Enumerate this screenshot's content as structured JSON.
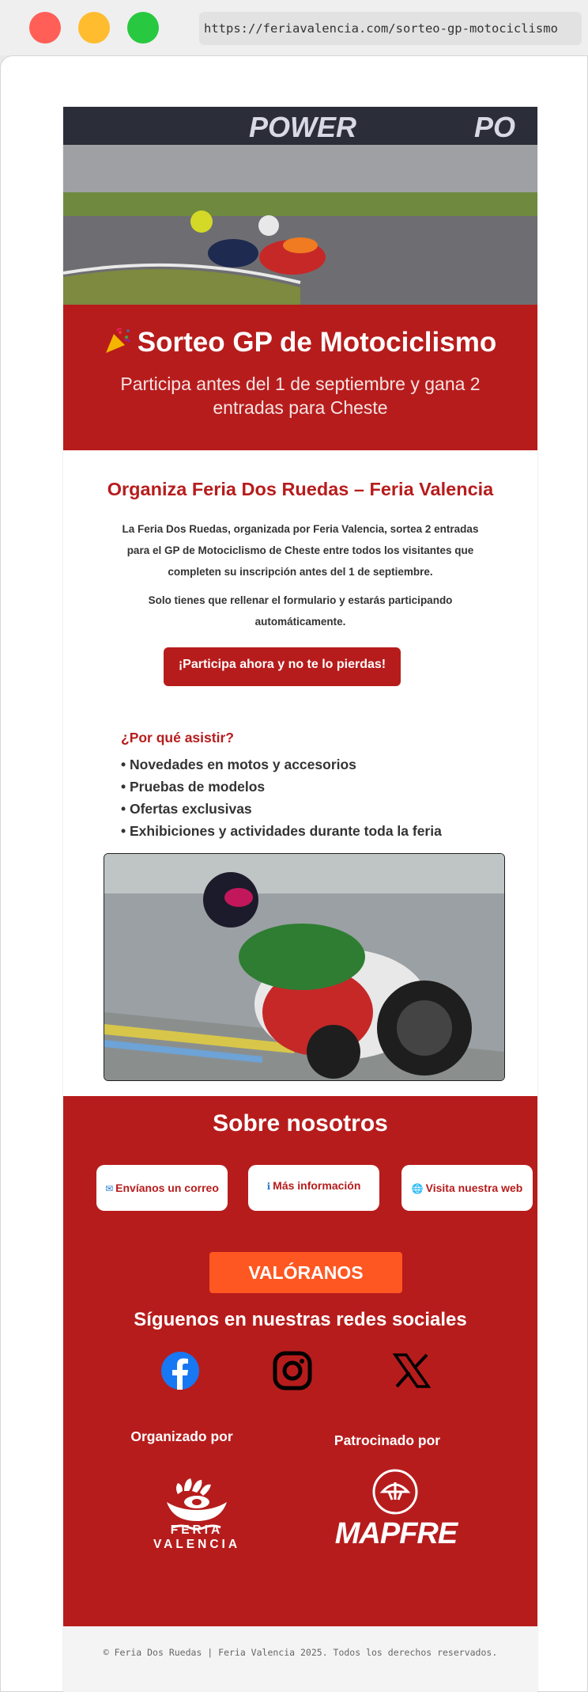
{
  "browser": {
    "url": "https://feriavalencia.com/sorteo-gp-motociclismo"
  },
  "banner": {
    "title": "Sorteo GP de Motociclismo",
    "subtitle": "Participa antes del 1 de septiembre y gana 2 entradas para Cheste"
  },
  "intro": {
    "heading": "Organiza Feria Dos Ruedas – Feria Valencia",
    "paragraph1": "La Feria Dos Ruedas, organizada por Feria Valencia, sortea 2 entradas para el GP de Motociclismo de Cheste entre todos los visitantes que completen su inscripción antes del 1 de septiembre.",
    "paragraph2": "Solo tienes que rellenar el formulario y estarás participando automáticamente.",
    "cta_label": "¡Participa ahora y no te lo pierdas!"
  },
  "why": {
    "heading": "¿Por qué asistir?",
    "items": [
      "• Novedades en motos y accesorios",
      "• Pruebas de modelos",
      "• Ofertas exclusivas",
      "• Exhibiciones y actividades durante toda la feria"
    ]
  },
  "footer": {
    "about_heading": "Sobre nosotros",
    "links": [
      {
        "label": "Envíanos un correo",
        "icon": "envelope-icon"
      },
      {
        "label": "Más información",
        "icon": "info-icon"
      },
      {
        "label": "Visita nuestra web",
        "icon": "globe-icon"
      }
    ],
    "rate_label": "VALÓRANOS",
    "follow_heading": "Síguenos en nuestras redes sociales",
    "social": [
      "facebook-icon",
      "instagram-icon",
      "x-icon"
    ],
    "organized_by": "Organizado por",
    "sponsored_by": "Patrocinado por",
    "organizer_logo_text": "FERIA VALENCIA",
    "sponsor_logo_text": "MAPFRE",
    "copyright": "© Feria Dos Ruedas | Feria Valencia 2025. Todos los derechos reservados."
  },
  "colors": {
    "brand_red": "#b71c1c",
    "accent_orange": "#ff5722",
    "facebook_blue": "#1877f2"
  }
}
